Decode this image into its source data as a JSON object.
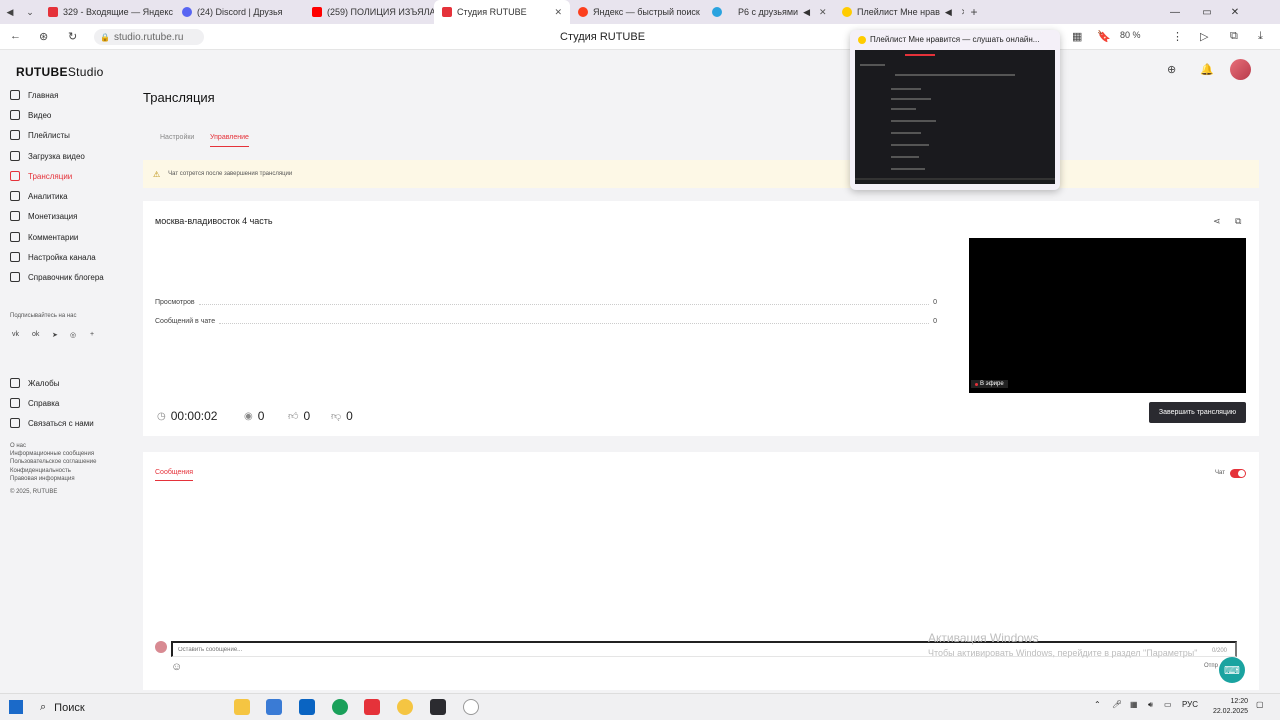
{
  "browser": {
    "tabs": [
      {
        "label": "329 - Входящие — Яндекс",
        "color": "#e5323a"
      },
      {
        "label": "(24) Discord | Друзья",
        "color": "#5865f2"
      },
      {
        "label": "(259) ПОЛИЦИЯ ИЗЪЯЛА",
        "color": "#ff0000"
      },
      {
        "label": "Студия RUTUBE",
        "color": "#e5323a"
      },
      {
        "label": "Яндекс — быстрый поиск",
        "color": "#fc3f1d"
      },
      {
        "label": "",
        "color": "#2aa3df"
      },
      {
        "label": "Р6 с друзьями",
        "color": "#666666"
      },
      {
        "label": "Плейлист Мне нрав",
        "color": "#ffcc00"
      }
    ],
    "url": "studio.rutube.ru",
    "page_title": "Студия RUTUBE",
    "zoom": "80 %",
    "tab_preview": {
      "title": "Плейлист Мне нравится — слушать онлайн..."
    }
  },
  "sidebar": {
    "logo_brand": "RUTUBE",
    "logo_suffix": "Studio",
    "items": [
      {
        "label": "Главная",
        "icon": "home-icon"
      },
      {
        "label": "Видео",
        "icon": "video-icon"
      },
      {
        "label": "Плейлисты",
        "icon": "playlist-icon"
      },
      {
        "label": "Загрузка видео",
        "icon": "upload-icon"
      },
      {
        "label": "Трансляции",
        "icon": "broadcast-icon"
      },
      {
        "label": "Аналитика",
        "icon": "analytics-icon"
      },
      {
        "label": "Монетизация",
        "icon": "money-icon"
      },
      {
        "label": "Комментарии",
        "icon": "comments-icon"
      },
      {
        "label": "Настройка канала",
        "icon": "settings-icon"
      },
      {
        "label": "Справочник блогера",
        "icon": "book-icon"
      }
    ],
    "subscribe_label": "Подписывайтесь на нас",
    "bottom_items": [
      {
        "label": "Жалобы",
        "icon": "flag-icon"
      },
      {
        "label": "Справка",
        "icon": "help-icon"
      },
      {
        "label": "Связаться с нами",
        "icon": "mail-icon"
      }
    ],
    "footer_links": [
      "О нас",
      "Информационные сообщения",
      "Пользовательское соглашение",
      "Конфиденциальность",
      "Правовая информация",
      "© 2025, RUTUBE"
    ]
  },
  "main": {
    "title": "Трансляция",
    "subtabs": [
      "Настройки",
      "Управление"
    ],
    "warning": "Чат сотрется после завершения трансляции",
    "stream_name": "москва-владивосток 4 часть",
    "stats": [
      {
        "label": "Просмотров",
        "value": "0"
      },
      {
        "label": "Сообщений в чате",
        "value": "0"
      }
    ],
    "metrics": {
      "duration": "00:00:02",
      "viewers": "0",
      "likes": "0",
      "dislikes": "0"
    },
    "on_air_label": "В эфире",
    "end_button": "Завершить трансляцию",
    "messages_tab": "Сообщения",
    "chat_label": "Чат",
    "message_placeholder": "Оставить сообщение...",
    "char_counter": "0/200",
    "send_label": "Отпр"
  },
  "watermark": {
    "line1": "Активация Windows",
    "line2": "Чтобы активировать Windows, перейдите в раздел \"Параметры\""
  },
  "taskbar": {
    "search": "Поиск",
    "lang": "РУС",
    "time": "12:20",
    "date": "22.02.2025"
  }
}
